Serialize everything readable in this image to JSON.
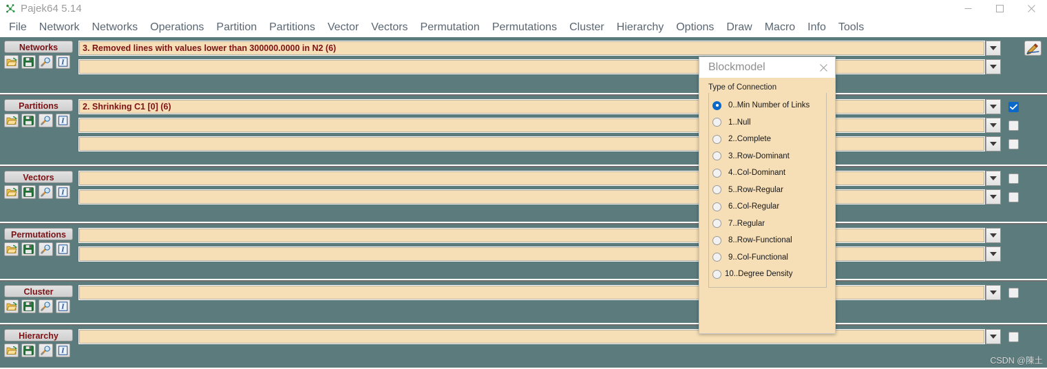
{
  "window": {
    "title": "Pajek64 5.14",
    "app_icon": "pajek-logo-icon",
    "controls": [
      {
        "name": "minimize-button",
        "glyph": "minimize-icon"
      },
      {
        "name": "maximize-button",
        "glyph": "maximize-icon"
      },
      {
        "name": "close-button",
        "glyph": "close-icon"
      }
    ]
  },
  "menubar": {
    "items": [
      "File",
      "Network",
      "Networks",
      "Operations",
      "Partition",
      "Partitions",
      "Vector",
      "Vectors",
      "Permutation",
      "Permutations",
      "Cluster",
      "Hierarchy",
      "Options",
      "Draw",
      "Macro",
      "Info",
      "Tools"
    ]
  },
  "toolbar_icons": [
    "open-folder-icon",
    "save-disk-icon",
    "magnifier-icon",
    "info-italic-i-icon"
  ],
  "panels": [
    {
      "label": "Networks",
      "rows": [
        {
          "value": "3. Removed lines with values lower than 300000.0000 in N2 (6)",
          "combo": true,
          "checkbox": null,
          "pencil": true
        },
        {
          "value": "",
          "combo": true,
          "checkbox": null,
          "pencil": false
        }
      ]
    },
    {
      "label": "Partitions",
      "rows": [
        {
          "value": "2. Shrinking C1 [0] (6)",
          "combo": true,
          "checkbox": "checked",
          "pencil": false
        },
        {
          "value": "",
          "combo": true,
          "checkbox": "unchecked",
          "pencil": false
        },
        {
          "value": "",
          "combo": true,
          "checkbox": "unchecked",
          "pencil": false
        }
      ]
    },
    {
      "label": "Vectors",
      "rows": [
        {
          "value": "",
          "combo": true,
          "checkbox": "unchecked",
          "pencil": false
        },
        {
          "value": "",
          "combo": true,
          "checkbox": "unchecked",
          "pencil": false
        }
      ]
    },
    {
      "label": "Permutations",
      "rows": [
        {
          "value": "",
          "combo": true,
          "checkbox": null,
          "pencil": false
        },
        {
          "value": "",
          "combo": true,
          "checkbox": null,
          "pencil": false
        }
      ]
    },
    {
      "label": "Cluster",
      "rows": [
        {
          "value": "",
          "combo": true,
          "checkbox": "unchecked",
          "pencil": false
        }
      ]
    },
    {
      "label": "Hierarchy",
      "rows": [
        {
          "value": "",
          "combo": true,
          "checkbox": "unchecked",
          "pencil": false
        }
      ]
    }
  ],
  "dialog": {
    "title": "Blockmodel",
    "close_icon": "close-icon",
    "group_label": "Type of Connection",
    "selected_index": 0,
    "options": [
      "0..Min Number of Links",
      "1..Null",
      "2..Complete",
      "3..Row-Dominant",
      "4..Col-Dominant",
      "5..Row-Regular",
      "6..Col-Regular",
      "7..Regular",
      "8..Row-Functional",
      "9..Col-Functional",
      "10..Degree Density"
    ]
  },
  "watermark": "CSDN @陳土",
  "colors": {
    "panel_bg": "#5c7b7d",
    "field_bg": "#f6dfb7",
    "label_text": "#7d1215",
    "accent_blue": "#0b68c8",
    "menu_text": "#5a6672"
  }
}
